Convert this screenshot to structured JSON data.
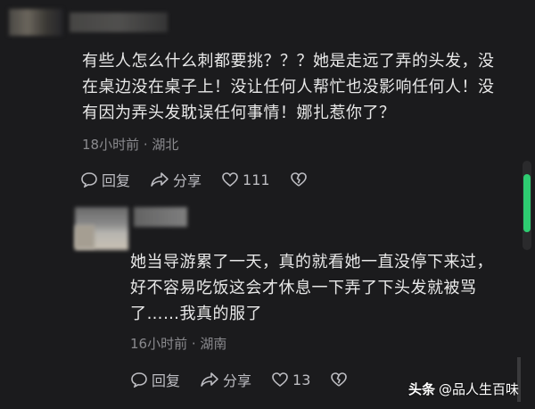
{
  "comments": [
    {
      "text": "有些人怎么什么刺都要挑？？？她是走远了弄的头发，没在桌边没在桌子上！没让任何人帮忙也没影响任何人！没有因为弄头发耽误任何事情！娜扎惹你了？",
      "meta": "18小时前 · 湖北",
      "reply_label": "回复",
      "share_label": "分享",
      "like_count": "111"
    },
    {
      "text": "她当导游累了一天，真的就看她一直没停下来过，好不容易吃饭这会才休息一下弄了下头发就被骂了……我真的服了",
      "meta": "16小时前 · 湖南",
      "reply_label": "回复",
      "share_label": "分享",
      "like_count": "13"
    }
  ],
  "watermark": {
    "brand": "头条",
    "account": "@品人生百味"
  },
  "colors": {
    "background": "#1b1b1d",
    "scroll_thumb": "#2ecc71"
  }
}
